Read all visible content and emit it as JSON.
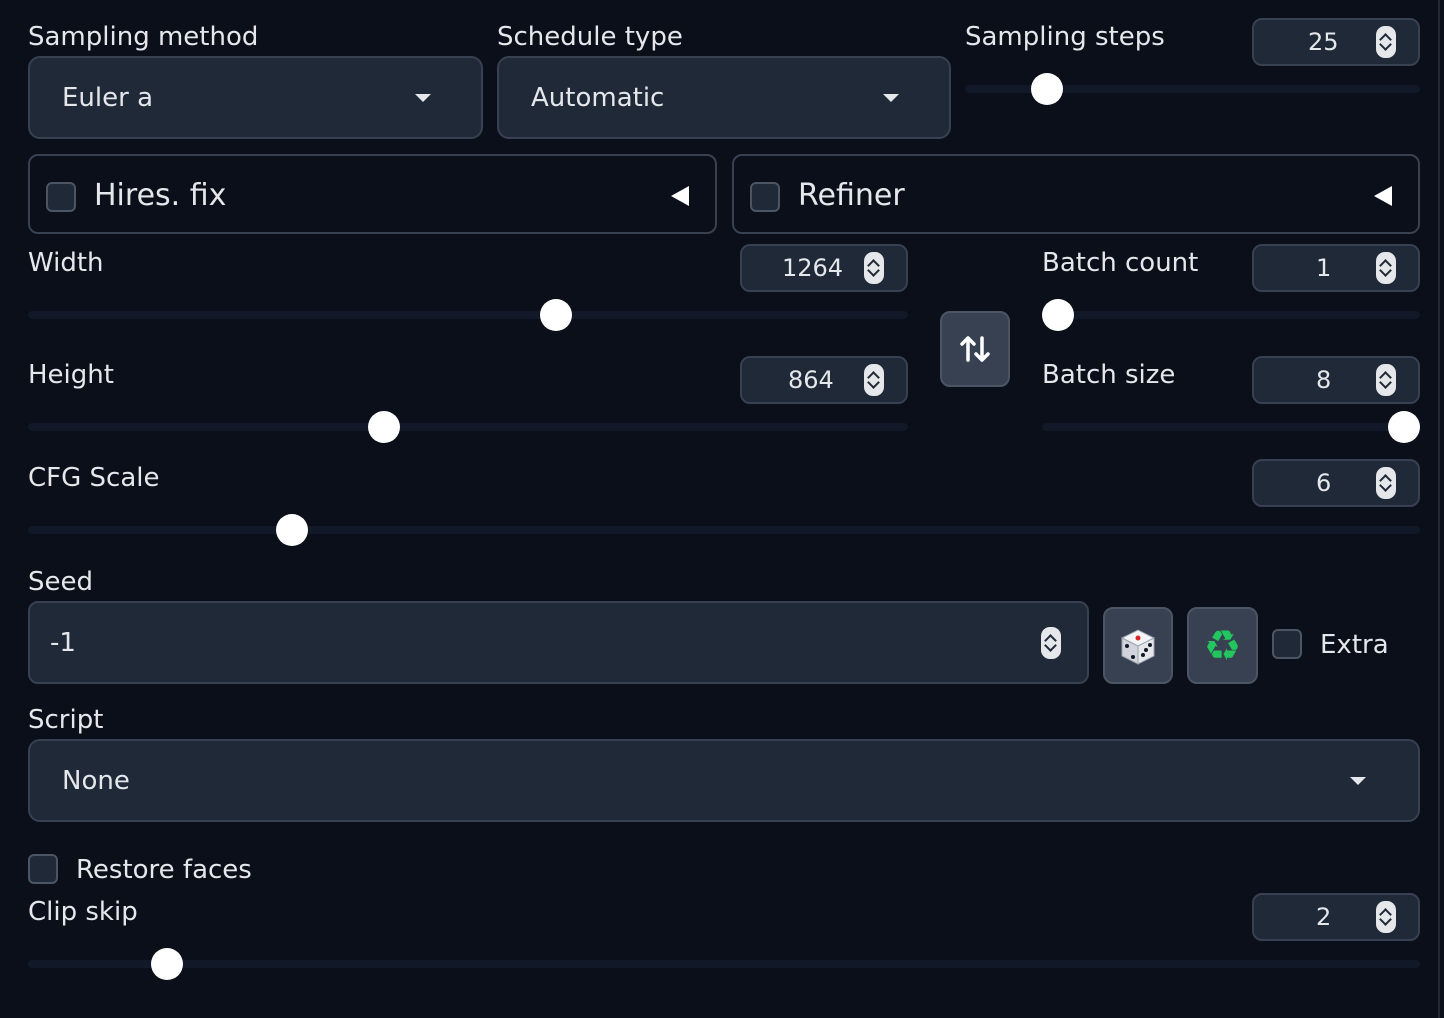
{
  "sampling_method": {
    "label": "Sampling method",
    "value": "Euler a"
  },
  "schedule_type": {
    "label": "Schedule type",
    "value": "Automatic"
  },
  "sampling_steps": {
    "label": "Sampling steps",
    "value": "25",
    "fraction": 0.18
  },
  "hires_fix": {
    "label": "Hires. fix",
    "checked": false
  },
  "refiner": {
    "label": "Refiner",
    "checked": false
  },
  "width": {
    "label": "Width",
    "value": "1264",
    "fraction": 0.6
  },
  "height": {
    "label": "Height",
    "value": "864",
    "fraction": 0.405
  },
  "batch_count": {
    "label": "Batch count",
    "value": "1",
    "fraction": 0.0
  },
  "batch_size": {
    "label": "Batch size",
    "value": "8",
    "fraction": 1.0
  },
  "cfg_scale": {
    "label": "CFG Scale",
    "value": "6",
    "fraction": 0.19
  },
  "seed": {
    "label": "Seed",
    "value": "-1",
    "extra_label": "Extra"
  },
  "script": {
    "label": "Script",
    "value": "None"
  },
  "restore_faces": {
    "label": "Restore faces",
    "checked": false
  },
  "clip_skip": {
    "label": "Clip skip",
    "value": "2",
    "fraction": 0.1
  },
  "icons": {
    "swap": "swap-arrows-icon",
    "dice": "dice-icon",
    "recycle": "recycle-icon",
    "caret": "caret-down-icon",
    "collapse": "collapse-triangle-icon"
  },
  "colors": {
    "background": "#0b0f19",
    "panel": "#1f2937",
    "border": "#374151",
    "text": "#e5e7eb"
  }
}
